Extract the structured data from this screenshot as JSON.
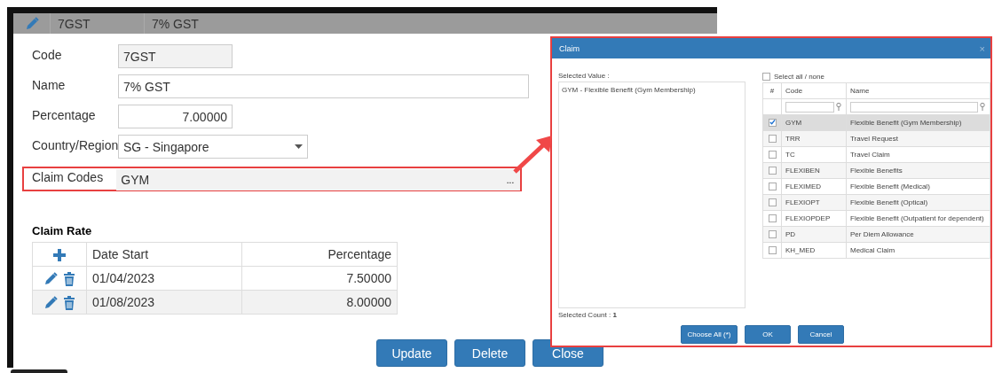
{
  "record_header": {
    "code": "7GST",
    "name": "7% GST"
  },
  "form": {
    "fields": [
      {
        "kind": "readonly",
        "label": "Code",
        "value": "7GST"
      },
      {
        "kind": "text",
        "label": "Name",
        "value": "7% GST"
      },
      {
        "kind": "number",
        "label": "Percentage",
        "value": "7.00000"
      },
      {
        "kind": "select",
        "label": "Country/Region",
        "value": "SG - Singapore"
      },
      {
        "kind": "lookup",
        "label": "Claim Codes",
        "value": "GYM",
        "button": "...",
        "highlighted": true
      }
    ]
  },
  "claim_rate": {
    "title": "Claim Rate",
    "columns": [
      "Date Start",
      "Percentage"
    ],
    "rows": [
      {
        "date_start": "01/04/2023",
        "percentage": "7.50000"
      },
      {
        "date_start": "01/08/2023",
        "percentage": "8.00000"
      }
    ]
  },
  "buttons": [
    "Update",
    "Delete",
    "Close"
  ],
  "dialog": {
    "title": "Claim",
    "close": "×",
    "selected_value_label": "Selected Value :",
    "selected_values": [
      "GYM - Flexible Benefit (Gym Membership)"
    ],
    "selected_count_label": "Selected Count : ",
    "selected_count": "1",
    "select_all": {
      "label": "Select all / none",
      "checked": false
    },
    "columns": [
      "#",
      "Code",
      "Name"
    ],
    "rows": [
      {
        "code": "GYM",
        "name": "Flexible Benefit (Gym Membership)",
        "checked": true,
        "selected": true
      },
      {
        "code": "TRR",
        "name": "Travel Request",
        "checked": false,
        "selected": false
      },
      {
        "code": "TC",
        "name": "Travel Claim",
        "checked": false,
        "selected": false
      },
      {
        "code": "FLEXIBEN",
        "name": "Flexible Benefits",
        "checked": false,
        "selected": false
      },
      {
        "code": "FLEXIMED",
        "name": "Flexible Benefit (Medical)",
        "checked": false,
        "selected": false
      },
      {
        "code": "FLEXIOPT",
        "name": "Flexible Benefit (Optical)",
        "checked": false,
        "selected": false
      },
      {
        "code": "FLEXIOPDEP",
        "name": "Flexible Benefit (Outpatient for dependent)",
        "checked": false,
        "selected": false
      },
      {
        "code": "PD",
        "name": "Per Diem Allowance",
        "checked": false,
        "selected": false
      },
      {
        "code": "KH_MED",
        "name": "Medical Claim",
        "checked": false,
        "selected": false
      }
    ],
    "buttons": [
      "Choose All (*)",
      "OK",
      "Cancel"
    ]
  }
}
